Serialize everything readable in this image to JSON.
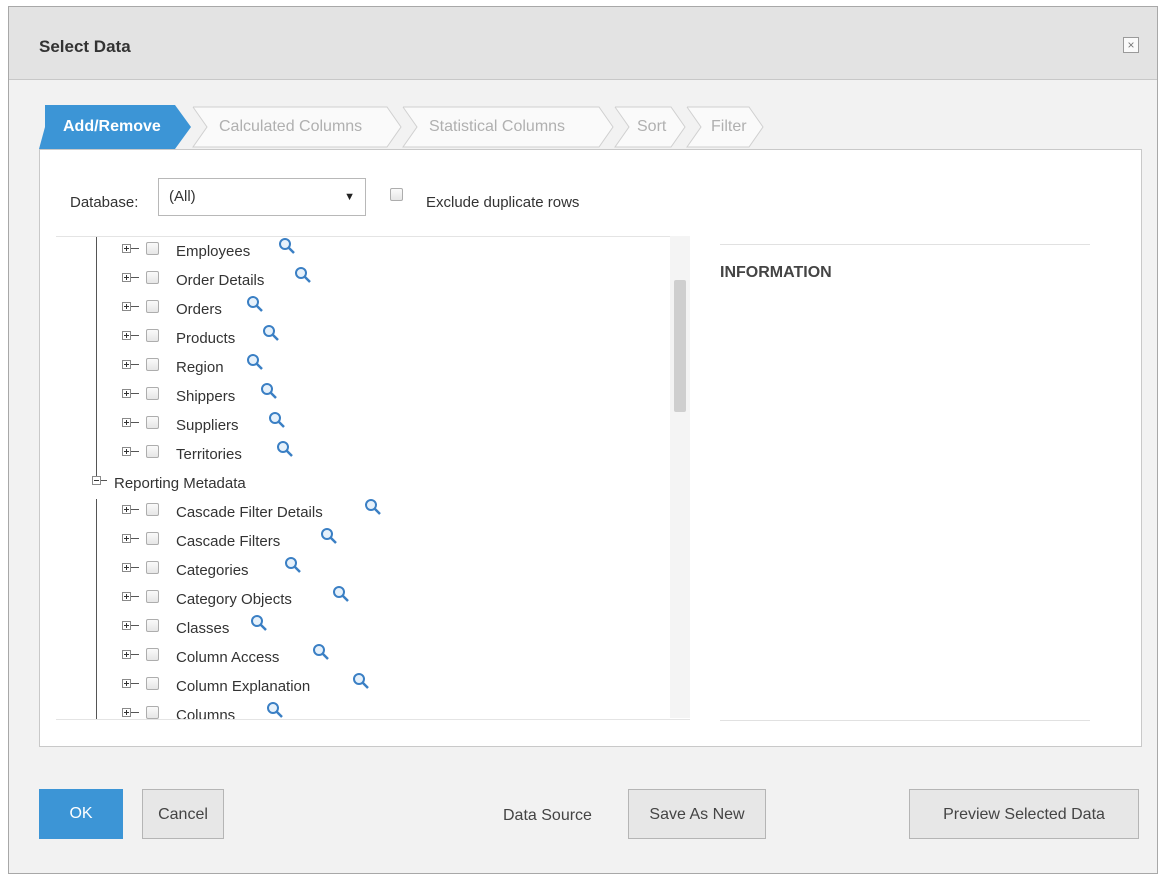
{
  "dialog": {
    "title": "Select Data",
    "close_glyph": "×"
  },
  "tabs": [
    {
      "label": "Add/Remove",
      "active": true
    },
    {
      "label": "Calculated Columns",
      "active": false
    },
    {
      "label": "Statistical Columns",
      "active": false
    },
    {
      "label": "Sort",
      "active": false
    },
    {
      "label": "Filter",
      "active": false
    }
  ],
  "database": {
    "label": "Database:",
    "selected": "(All)"
  },
  "exclude_duplicates": {
    "label": "Exclude duplicate rows",
    "checked": false
  },
  "tree": {
    "first_group_tables": [
      "Employees",
      "Order Details",
      "Orders",
      "Products",
      "Region",
      "Shippers",
      "Suppliers",
      "Territories"
    ],
    "second_group": {
      "label": "Reporting Metadata",
      "tables": [
        "Cascade Filter Details",
        "Cascade Filters",
        "Categories",
        "Category Objects",
        "Classes",
        "Column Access",
        "Column Explanation",
        "Columns"
      ]
    }
  },
  "info": {
    "title": "INFORMATION"
  },
  "footer": {
    "ok": "OK",
    "cancel": "Cancel",
    "data_source_label": "Data Source",
    "save_as_new": "Save As New",
    "preview": "Preview Selected Data"
  },
  "colors": {
    "accent": "#3c95d6",
    "tab_inactive_text": "#b0b0b0",
    "magnifier": "#3a7fc4"
  }
}
